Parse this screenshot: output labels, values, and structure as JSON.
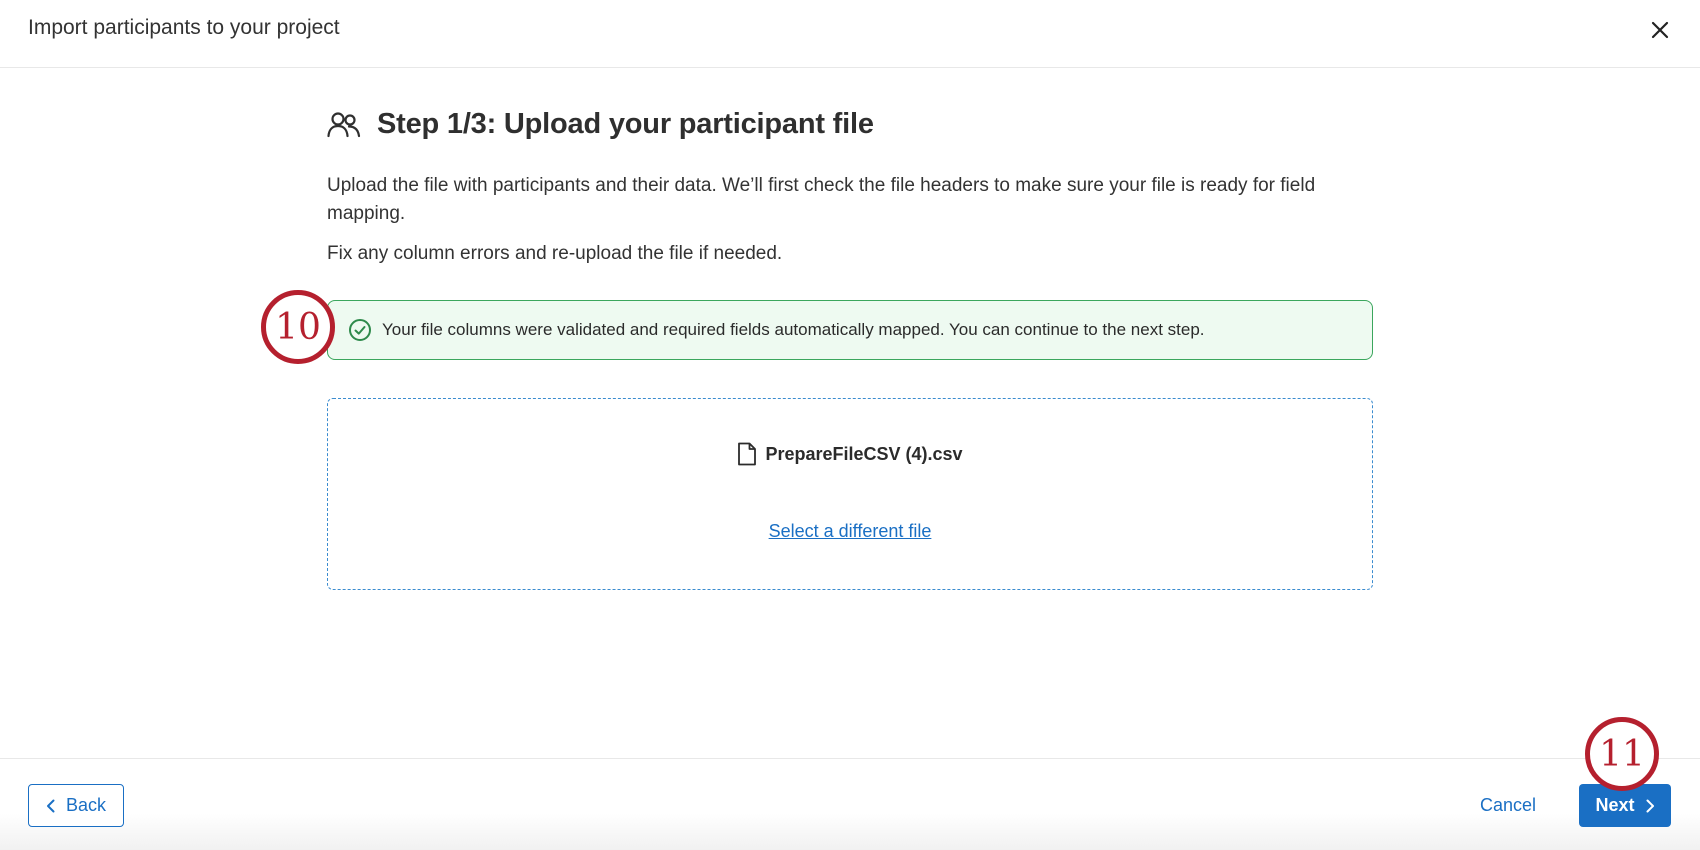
{
  "header": {
    "title": "Import participants to your project",
    "close_icon": "close-icon"
  },
  "step": {
    "icon": "participants-icon",
    "title": "Step 1/3: Upload your participant file",
    "description": "Upload the file with participants and their data. We’ll first check the file headers to make sure your file is ready for field mapping.",
    "note": "Fix any column errors and re-upload the file if needed."
  },
  "alert": {
    "icon": "check-circle-icon",
    "text": "Your file columns were validated and required fields automatically mapped. You can continue to the next step.",
    "color": "#3ba65d"
  },
  "dropzone": {
    "file_icon": "file-icon",
    "file_name": "PrepareFileCSV (4).csv",
    "change_link": "Select a different file"
  },
  "callouts": {
    "first": "10",
    "second": "11",
    "color": "#b5202e"
  },
  "footer": {
    "back_label": "Back",
    "cancel_label": "Cancel",
    "next_label": "Next"
  },
  "colors": {
    "accent": "#1a6fc4",
    "success": "#3ba65d"
  }
}
